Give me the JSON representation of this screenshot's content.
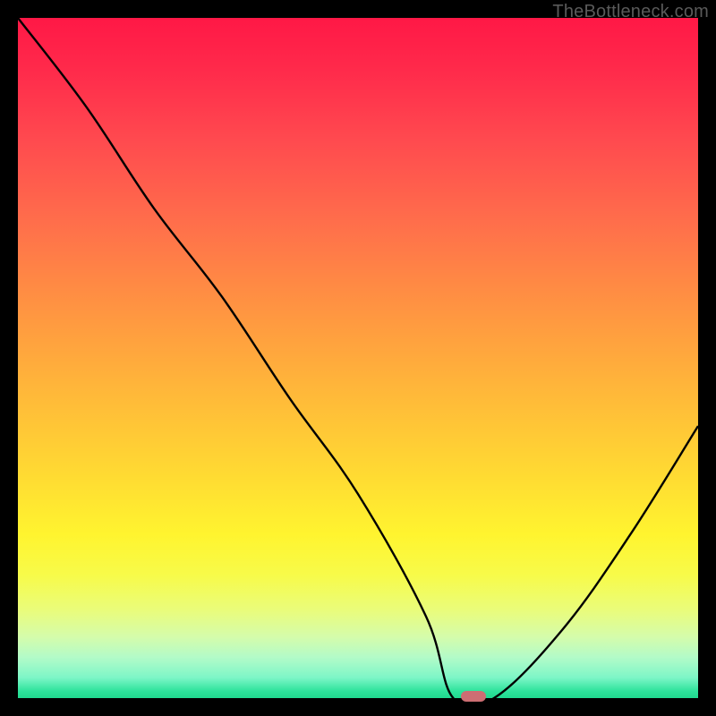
{
  "watermark": "TheBottleneck.com",
  "colors": {
    "background": "#000000",
    "gradient_top": "#ff1846",
    "gradient_mid": "#ffd733",
    "gradient_bottom": "#20d98f",
    "curve": "#000000",
    "marker": "#cd6e73"
  },
  "chart_data": {
    "type": "line",
    "title": "",
    "xlabel": "",
    "ylabel": "",
    "xlim": [
      0,
      100
    ],
    "ylim": [
      0,
      100
    ],
    "grid": false,
    "legend": false,
    "annotations": [],
    "series": [
      {
        "name": "bottleneck-curve",
        "x": [
          0,
          10,
          20,
          30,
          40,
          50,
          60,
          64,
          70,
          80,
          90,
          100
        ],
        "y": [
          100,
          87,
          72,
          59,
          44,
          30,
          12,
          0,
          0,
          10,
          24,
          40
        ]
      }
    ],
    "marker": {
      "x": 67,
      "y": 0
    }
  }
}
